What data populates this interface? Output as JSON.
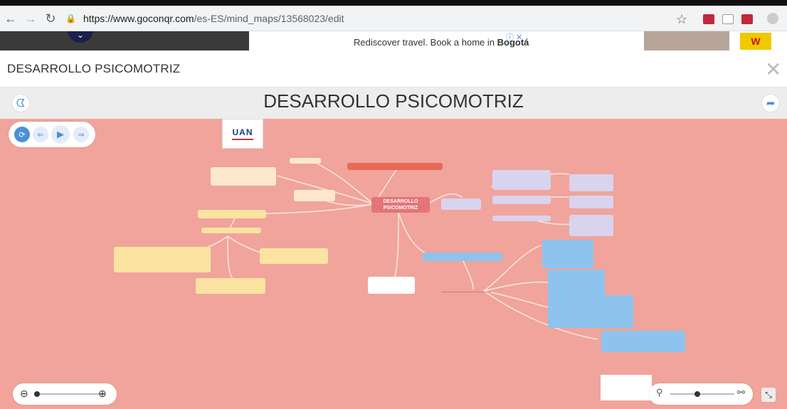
{
  "browser": {
    "url_host": "https://www.goconqr.com",
    "url_path": "/es-ES/mind_maps/13568023/edit"
  },
  "ad": {
    "text_prefix": "Rediscover travel. Book a home in ",
    "text_bold": "Bogotá",
    "info_label": "ⓘ ✕"
  },
  "header": {
    "title": "DESARROLLO PSICOMOTRIZ"
  },
  "toolbar": {
    "title": "DESARROLLO PSICOMOTRIZ"
  },
  "mindmap": {
    "center_label": "DESARROLLO PSICOMOTRIZ",
    "logo_text": "UAN"
  },
  "colors": {
    "canvas": "#f0a49b",
    "accent": "#4a90d9",
    "center_node": "#e5737a"
  }
}
